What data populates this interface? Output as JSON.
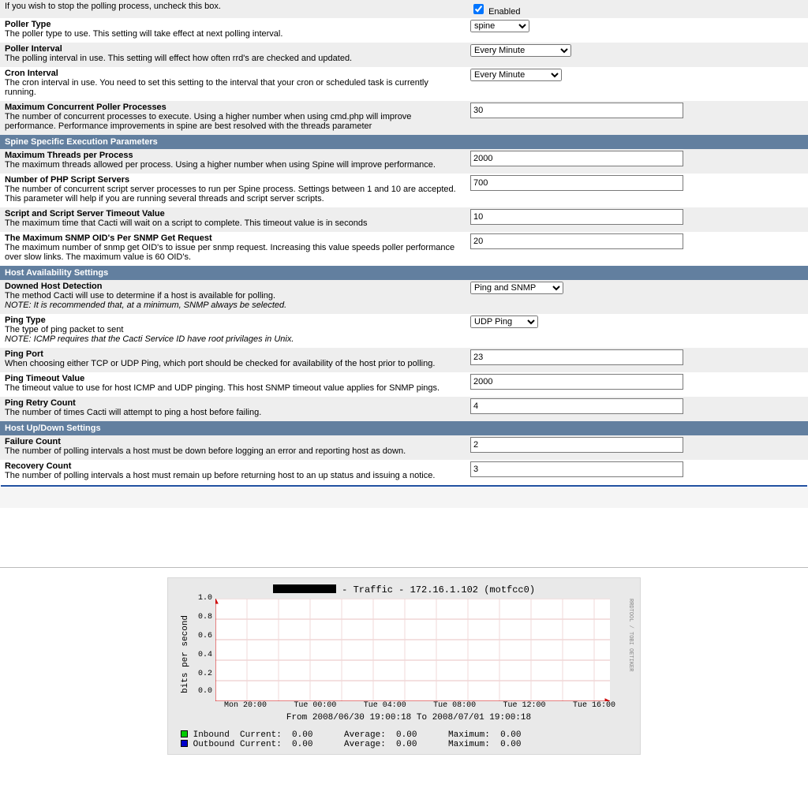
{
  "rows": {
    "enabled": {
      "title": "Enabled",
      "desc": "If you wish to stop the polling process, uncheck this box.",
      "checkbox_label": "Enabled",
      "checked": true
    },
    "poller_type": {
      "title": "Poller Type",
      "desc": "The poller type to use. This setting will take effect at next polling interval.",
      "value": "spine"
    },
    "poller_interval": {
      "title": "Poller Interval",
      "desc": "The polling interval in use. This setting will effect how often rrd's are checked and updated.",
      "value": "Every Minute"
    },
    "cron_interval": {
      "title": "Cron Interval",
      "desc": "The cron interval in use. You need to set this setting to the interval that your cron or scheduled task is currently running.",
      "value": "Every Minute"
    },
    "max_processes": {
      "title": "Maximum Concurrent Poller Processes",
      "desc": "The number of concurrent processes to execute. Using a higher number when using cmd.php will improve performance. Performance improvements in spine are best resolved with the threads parameter",
      "value": "30"
    },
    "section_spine": {
      "label": "Spine Specific Execution Parameters"
    },
    "max_threads": {
      "title": "Maximum Threads per Process",
      "desc": "The maximum threads allowed per process. Using a higher number when using Spine will improve performance.",
      "value": "2000"
    },
    "php_servers": {
      "title": "Number of PHP Script Servers",
      "desc": "The number of concurrent script server processes to run per Spine process. Settings between 1 and 10 are accepted. This parameter will help if you are running several threads and script server scripts.",
      "value": "700"
    },
    "script_timeout": {
      "title": "Script and Script Server Timeout Value",
      "desc": "The maximum time that Cacti will wait on a script to complete. This timeout value is in seconds",
      "value": "10"
    },
    "max_oids": {
      "title": "The Maximum SNMP OID's Per SNMP Get Request",
      "desc": "The maximum number of snmp get OID's to issue per snmp request. Increasing this value speeds poller performance over slow links. The maximum value is 60 OID's.",
      "value": "20"
    },
    "section_avail": {
      "label": "Host Availability Settings"
    },
    "downed_host": {
      "title": "Downed Host Detection",
      "desc": "The method Cacti will use to determine if a host is available for polling.",
      "note": "NOTE: It is recommended that, at a minimum, SNMP always be selected.",
      "value": "Ping and SNMP"
    },
    "ping_type": {
      "title": "Ping Type",
      "desc": "The type of ping packet to sent",
      "note": "NOTE: ICMP requires that the Cacti Service ID have root privilages in Unix.",
      "value": "UDP Ping"
    },
    "ping_port": {
      "title": "Ping Port",
      "desc": "When choosing either TCP or UDP Ping, which port should be checked for availability of the host prior to polling.",
      "value": "23"
    },
    "ping_timeout": {
      "title": "Ping Timeout Value",
      "desc": "The timeout value to use for host ICMP and UDP pinging. This host SNMP timeout value applies for SNMP pings.",
      "value": "2000"
    },
    "ping_retry": {
      "title": "Ping Retry Count",
      "desc": "The number of times Cacti will attempt to ping a host before failing.",
      "value": "4"
    },
    "section_updown": {
      "label": "Host Up/Down Settings"
    },
    "failure_count": {
      "title": "Failure Count",
      "desc": "The number of polling intervals a host must be down before logging an error and reporting host as down.",
      "value": "2"
    },
    "recovery_count": {
      "title": "Recovery Count",
      "desc": "The number of polling intervals a host must remain up before returning host to an up status and issuing a notice.",
      "value": "3"
    }
  },
  "chart_data": {
    "type": "line",
    "title_mid": " - Traffic - ",
    "title_host": "172.16.1.102 (motfcc0)",
    "ylabel": "bits per second",
    "ylim": [
      0,
      1.0
    ],
    "yticks": [
      "1.0",
      "0.8",
      "0.6",
      "0.4",
      "0.2",
      "0.0"
    ],
    "x_categories": [
      "Mon 20:00",
      "Tue 00:00",
      "Tue 04:00",
      "Tue 08:00",
      "Tue 12:00",
      "Tue 16:00"
    ],
    "range_text": "From 2008/06/30 19:00:18 To 2008/07/01 19:00:18",
    "series": [
      {
        "name": "Inbound",
        "color": "#00cc00",
        "values": [
          0,
          0,
          0,
          0,
          0,
          0
        ]
      },
      {
        "name": "Outbound",
        "color": "#0000cc",
        "values": [
          0,
          0,
          0,
          0,
          0,
          0
        ]
      }
    ],
    "legend_rows": [
      {
        "swatch": "#00cc00",
        "name": "Inbound",
        "current": "0.00",
        "average": "0.00",
        "maximum": "0.00"
      },
      {
        "swatch": "#0000cc",
        "name": "Outbound",
        "current": "0.00",
        "average": "0.00",
        "maximum": "0.00"
      }
    ],
    "legend_labels": {
      "current": "Current:",
      "average": "Average:",
      "maximum": "Maximum:"
    },
    "rrd_mark": "RRDTOOL / TOBI OETIKER"
  }
}
